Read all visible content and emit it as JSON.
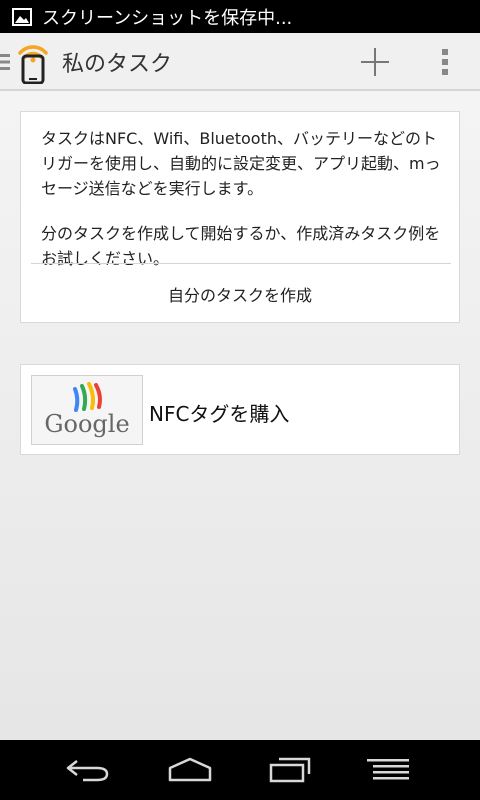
{
  "status_bar": {
    "icon": "image-icon",
    "text": "スクリーンショットを保存中..."
  },
  "action_bar": {
    "app_icon": "nfc-phone-icon",
    "title": "私のタスク",
    "add_icon": "plus-icon",
    "overflow_icon": "overflow-menu-icon"
  },
  "intro_card": {
    "description_1": "タスクはNFC、Wifi、Bluetooth、バッテリーなどのトリガーを使用し、自動的に設定変更、アプリ起動、mっセージ送信などを実行します。",
    "description_2": "分のタスクを作成して開始するか、作成済みタスク例をお試しください。",
    "create_button_label": "自分のタスクを作成"
  },
  "nfc_card": {
    "logo_text": "Google",
    "label": "NFCタグを購入"
  },
  "nav_bar": {
    "back_icon": "back-icon",
    "home_icon": "home-icon",
    "recents_icon": "recents-icon",
    "menu_icon": "menu-icon"
  },
  "colors": {
    "accent_orange": "#f5a623",
    "status_bar_bg": "#000000",
    "action_bar_bg": "#f0f0f0"
  }
}
